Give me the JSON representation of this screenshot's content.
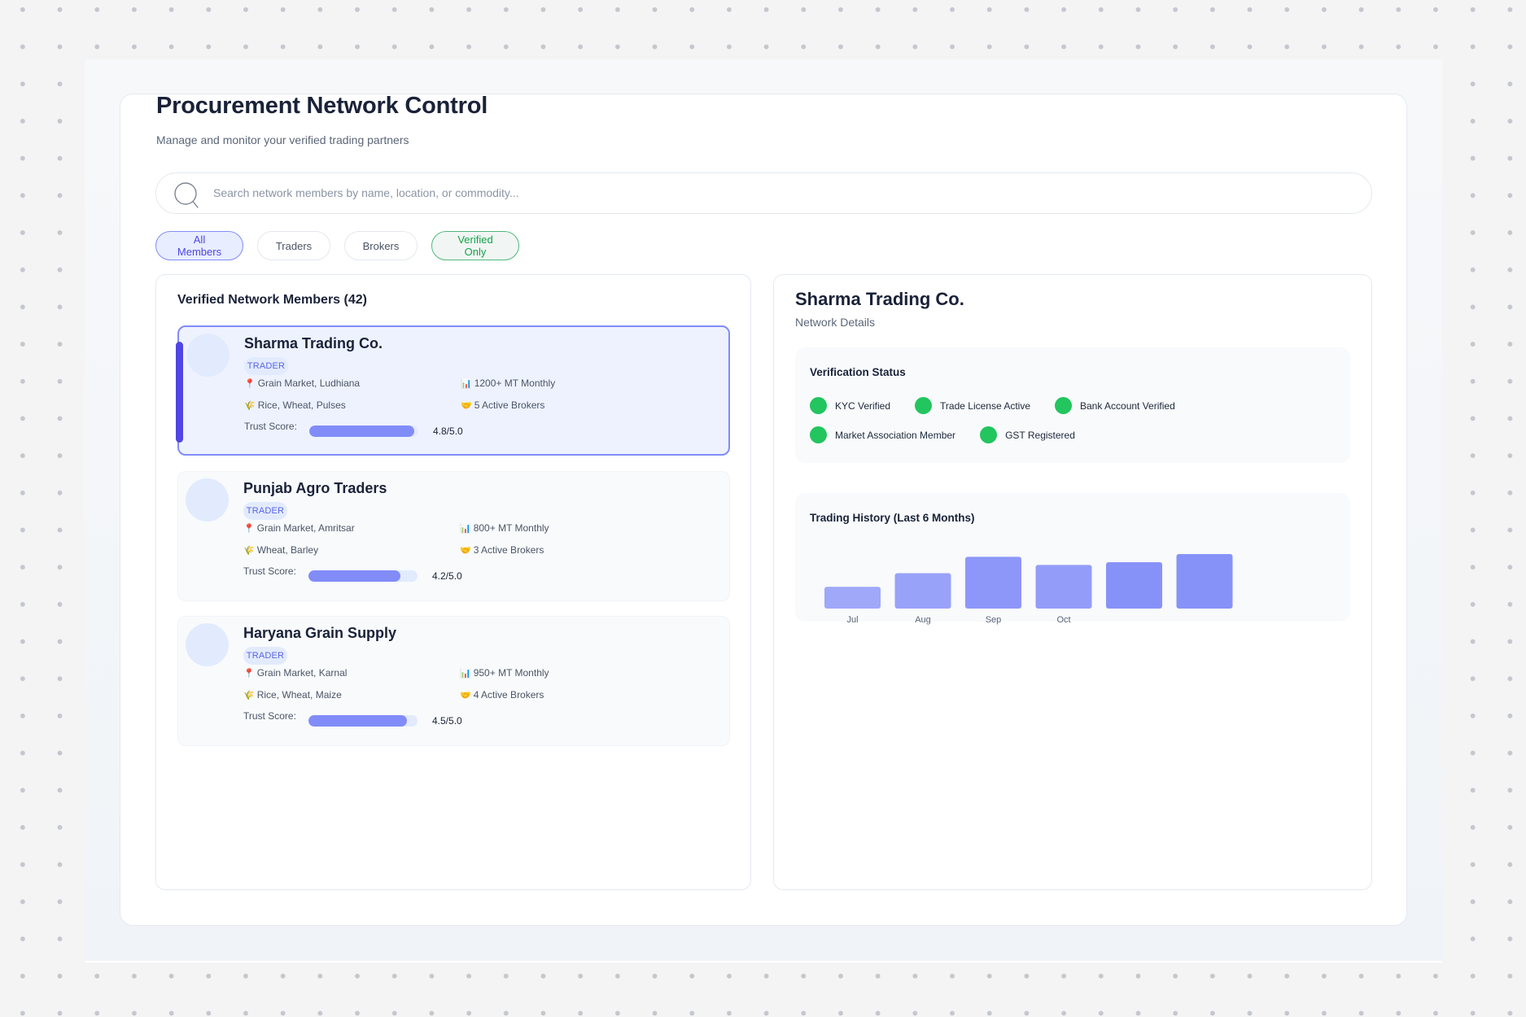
{
  "header": {
    "title": "Procurement Network Control",
    "subtitle": "Manage and monitor your verified trading partners"
  },
  "search": {
    "icon": "search-icon",
    "placeholder": "Search network members by name, location, or commodity...",
    "value": ""
  },
  "filters": [
    {
      "label": "All Members",
      "state": "active"
    },
    {
      "label": "Traders",
      "state": "default"
    },
    {
      "label": "Brokers",
      "state": "default"
    },
    {
      "label": "Verified Only",
      "state": "verified"
    }
  ],
  "members_panel": {
    "heading": "Verified Network Members (42)",
    "trust_label": "Trust Score:",
    "icons": {
      "location": "📍",
      "commodity": "🌾",
      "volume": "📊",
      "brokers": "🤝"
    },
    "members": [
      {
        "name": "Sharma Trading Co.",
        "type": "TRADER",
        "selected": true,
        "location": "Grain Market, Ludhiana",
        "commodities": "Rice, Wheat, Pulses",
        "volume": "1200+ MT Monthly",
        "brokers": "5 Active Brokers",
        "trust_score": 4.8,
        "trust_max": 5.0,
        "trust_text": "4.8/5.0"
      },
      {
        "name": "Punjab Agro Traders",
        "type": "TRADER",
        "selected": false,
        "location": "Grain Market, Amritsar",
        "commodities": "Wheat, Barley",
        "volume": "800+ MT Monthly",
        "brokers": "3 Active Brokers",
        "trust_score": 4.2,
        "trust_max": 5.0,
        "trust_text": "4.2/5.0"
      },
      {
        "name": "Haryana Grain Supply",
        "type": "TRADER",
        "selected": false,
        "location": "Grain Market, Karnal",
        "commodities": "Rice, Wheat, Maize",
        "volume": "950+ MT Monthly",
        "brokers": "4 Active Brokers",
        "trust_score": 4.5,
        "trust_max": 5.0,
        "trust_text": "4.5/5.0"
      }
    ]
  },
  "details": {
    "title": "Sharma Trading Co.",
    "subtitle": "Network Details",
    "verification": {
      "title": "Verification Status",
      "status_color": "#22c55e",
      "items": [
        "KYC Verified",
        "Trade License Active",
        "Bank Account Verified",
        "Market Association Member",
        "GST Registered"
      ]
    },
    "trading_history": {
      "title": "Trading History (Last 6 Months)"
    }
  },
  "chart_data": {
    "type": "bar",
    "title": "Trading History (Last 6 Months)",
    "categories": [
      "Jul",
      "Aug",
      "Sep",
      "Oct",
      "",
      ""
    ],
    "values": [
      40,
      65,
      95,
      80,
      85,
      100
    ],
    "xlabel": "",
    "ylabel": "",
    "ylim": [
      0,
      100
    ],
    "grid": false,
    "bar_color": "#818cf8",
    "opacities": [
      0.75,
      0.8,
      0.9,
      0.85,
      0.95,
      0.95
    ]
  }
}
